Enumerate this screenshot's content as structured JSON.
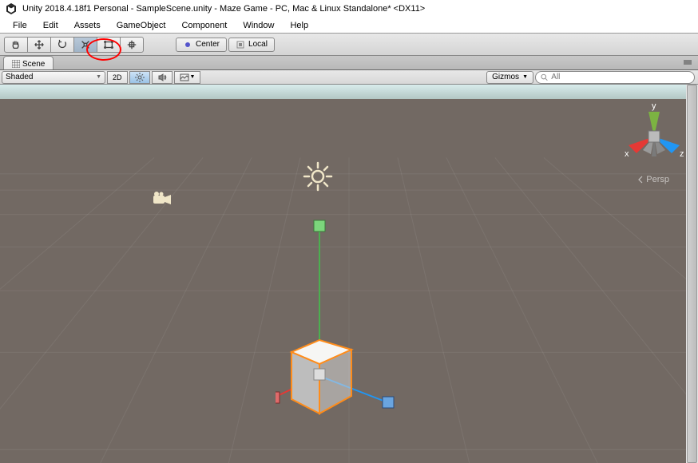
{
  "title_bar": {
    "text": "Unity 2018.4.18f1 Personal - SampleScene.unity - Maze Game - PC, Mac & Linux Standalone* <DX11>"
  },
  "menu": {
    "items": [
      "File",
      "Edit",
      "Assets",
      "GameObject",
      "Component",
      "Window",
      "Help"
    ]
  },
  "toolbar": {
    "tools": [
      "hand",
      "move",
      "rotate",
      "scale",
      "rect",
      "transform"
    ],
    "active_tool": "scale",
    "pivot_mode": "Center",
    "handle_mode": "Local"
  },
  "tabs": {
    "active": "Scene"
  },
  "scene_toolbar": {
    "shading": "Shaded",
    "mode_2d": "2D",
    "gizmos": "Gizmos",
    "search_placeholder": "All"
  },
  "viewport": {
    "projection": "Persp",
    "axes": {
      "x": "x",
      "y": "y",
      "z": "z"
    }
  }
}
